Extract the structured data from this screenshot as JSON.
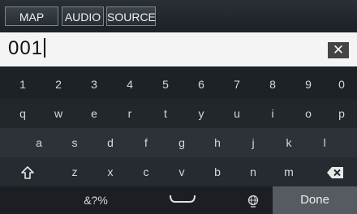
{
  "tabs": [
    "MAP",
    "AUDIO",
    "SOURCE"
  ],
  "input": {
    "value": "001"
  },
  "icons": {
    "clear": "clear-icon",
    "shift": "shift-icon",
    "backspace": "backspace-icon",
    "space": "space-icon",
    "globe": "globe-icon"
  },
  "keyboard": {
    "row0": [
      "1",
      "2",
      "3",
      "4",
      "5",
      "6",
      "7",
      "8",
      "9",
      "0"
    ],
    "row1": [
      "q",
      "w",
      "e",
      "r",
      "t",
      "y",
      "u",
      "i",
      "o",
      "p"
    ],
    "row2": [
      "a",
      "s",
      "d",
      "f",
      "g",
      "h",
      "j",
      "k",
      "l"
    ],
    "row3": [
      "z",
      "x",
      "c",
      "v",
      "b",
      "n",
      "m"
    ],
    "symbols": "&?%",
    "done": "Done"
  }
}
